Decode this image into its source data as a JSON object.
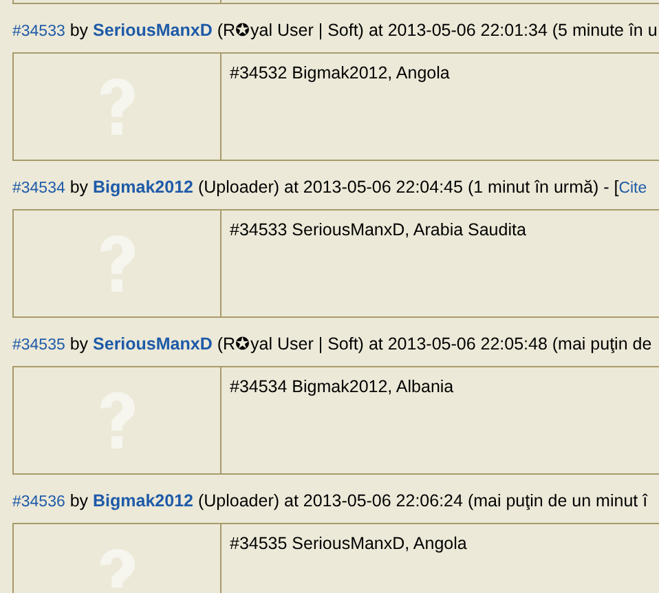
{
  "posts": [
    {
      "number": "#34533",
      "by": "by",
      "author": "SeriousManxD",
      "role": "(R✪yal User | Soft)",
      "meta": "at 2013-05-06 22:01:34 (5 minute în u",
      "body": "#34532 Bigmak2012, Angola"
    },
    {
      "number": "#34534",
      "by": "by",
      "author": "Bigmak2012",
      "role": "(Uploader)",
      "meta": "at 2013-05-06 22:04:45 (1 minut în urmă) - [",
      "link": "Cite",
      "body": "#34533 SeriousManxD, Arabia Saudita"
    },
    {
      "number": "#34535",
      "by": "by",
      "author": "SeriousManxD",
      "role": "(R✪yal User | Soft)",
      "meta": "at 2013-05-06 22:05:48 (mai puţin de",
      "body": "#34534 Bigmak2012, Albania"
    },
    {
      "number": "#34536",
      "by": "by",
      "author": "Bigmak2012",
      "role": "(Uploader)",
      "meta": "at 2013-05-06 22:06:24 (mai puţin de un minut î",
      "body": "#34535 SeriousManxD, Angola"
    }
  ]
}
